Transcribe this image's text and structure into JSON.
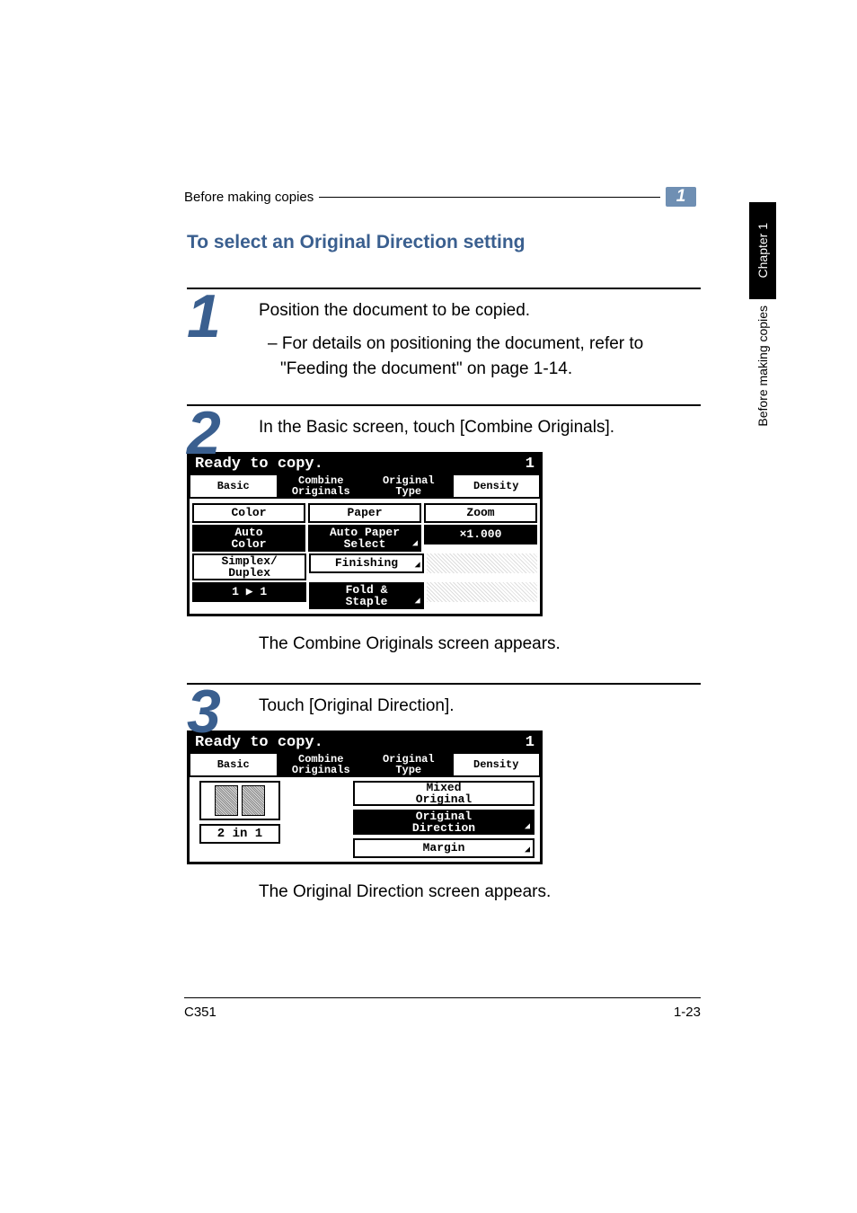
{
  "header": {
    "text": "Before making copies",
    "chapter_num": "1"
  },
  "section_title": "To select an Original Direction setting",
  "sidebar": {
    "tab": "Chapter 1",
    "label": "Before making copies"
  },
  "steps": {
    "s1": {
      "num": "1",
      "line1": "Position the document to be copied.",
      "sub1": "– For details on positioning the document, refer to \"Feeding the document\" on page 1-14."
    },
    "s2": {
      "num": "2",
      "line1": "In the Basic screen, touch [Combine Originals].",
      "after": "The Combine Originals screen appears."
    },
    "s3": {
      "num": "3",
      "line1": "Touch [Original Direction].",
      "after": "The Original Direction screen appears."
    }
  },
  "lcd1": {
    "title_left": "Ready to copy.",
    "title_right": "1",
    "tabs": {
      "basic": "Basic",
      "combine": "Combine\nOriginals",
      "orig_type": "Original\nType",
      "density": "Density"
    },
    "r1": {
      "color_h": "Color",
      "paper_h": "Paper",
      "zoom_h": "Zoom"
    },
    "r2": {
      "color_v": "Auto\nColor",
      "paper_v": "Auto Paper\nSelect",
      "zoom_v": "×1.000"
    },
    "r3": {
      "simplex_h": "Simplex/\nDuplex",
      "finishing_h": "Finishing"
    },
    "r4": {
      "simplex_v": "1 ▶ 1",
      "fold_v": "Fold &\nStaple"
    }
  },
  "lcd2": {
    "title_left": "Ready to copy.",
    "title_right": "1",
    "tabs": {
      "basic": "Basic",
      "combine": "Combine\nOriginals",
      "orig_type": "Original\nType",
      "density": "Density"
    },
    "left_btn": "2 in 1",
    "right": {
      "mixed": "Mixed\nOriginal",
      "direction": "Original\nDirection",
      "margin": "Margin"
    }
  },
  "footer": {
    "left": "C351",
    "right": "1-23"
  }
}
